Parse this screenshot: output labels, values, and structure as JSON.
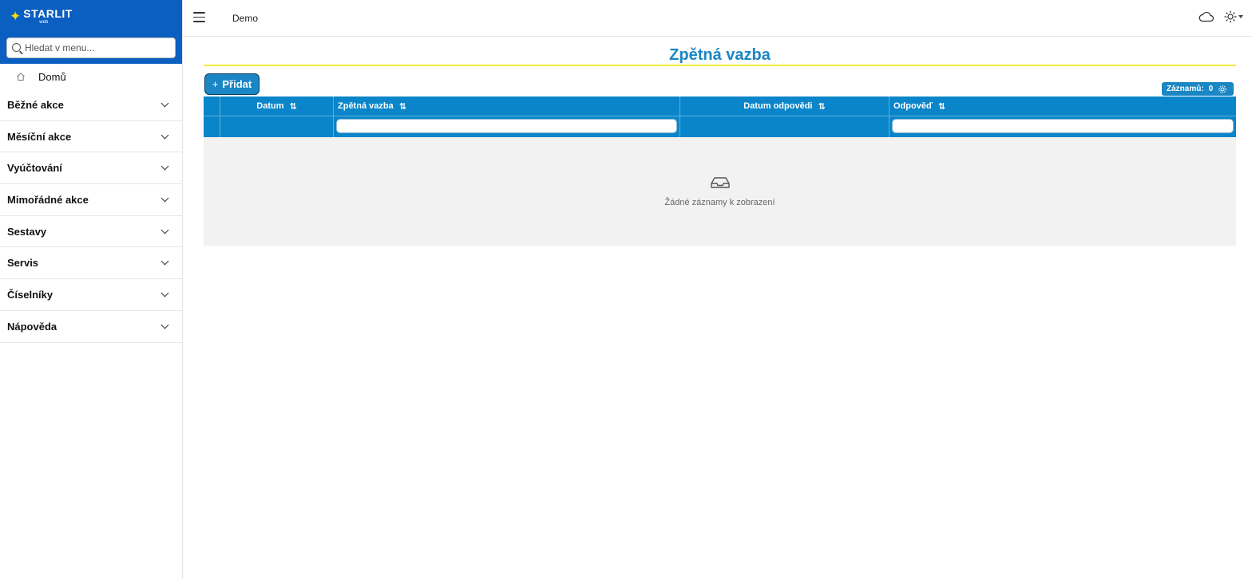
{
  "brand": {
    "name": "STARLIT",
    "sub": "web",
    "accent": "#0a5fc0",
    "star_color": "#f5d90a"
  },
  "search": {
    "placeholder": "Hledat v menu...",
    "value": ""
  },
  "home": {
    "label": "Domů"
  },
  "menu": [
    {
      "label": "Běžné akce"
    },
    {
      "label": "Měsíční akce"
    },
    {
      "label": "Vyúčtování"
    },
    {
      "label": "Mimořádné akce"
    },
    {
      "label": "Sestavy"
    },
    {
      "label": "Servis"
    },
    {
      "label": "Číselníky"
    },
    {
      "label": "Nápověda"
    }
  ],
  "topbar": {
    "env": "Demo"
  },
  "page": {
    "title": "Zpětná vazba",
    "title_color": "#1a86c4",
    "add_button": "Přidat",
    "records_label": "Záznamů:",
    "records_count": "0"
  },
  "grid": {
    "header_color": "#0a85c9",
    "columns": [
      {
        "label": "Datum"
      },
      {
        "label": "Zpětná vazba"
      },
      {
        "label": "Datum odpovědi"
      },
      {
        "label": "Odpověď"
      }
    ],
    "empty_text": "Žádné záznamy k zobrazení"
  }
}
